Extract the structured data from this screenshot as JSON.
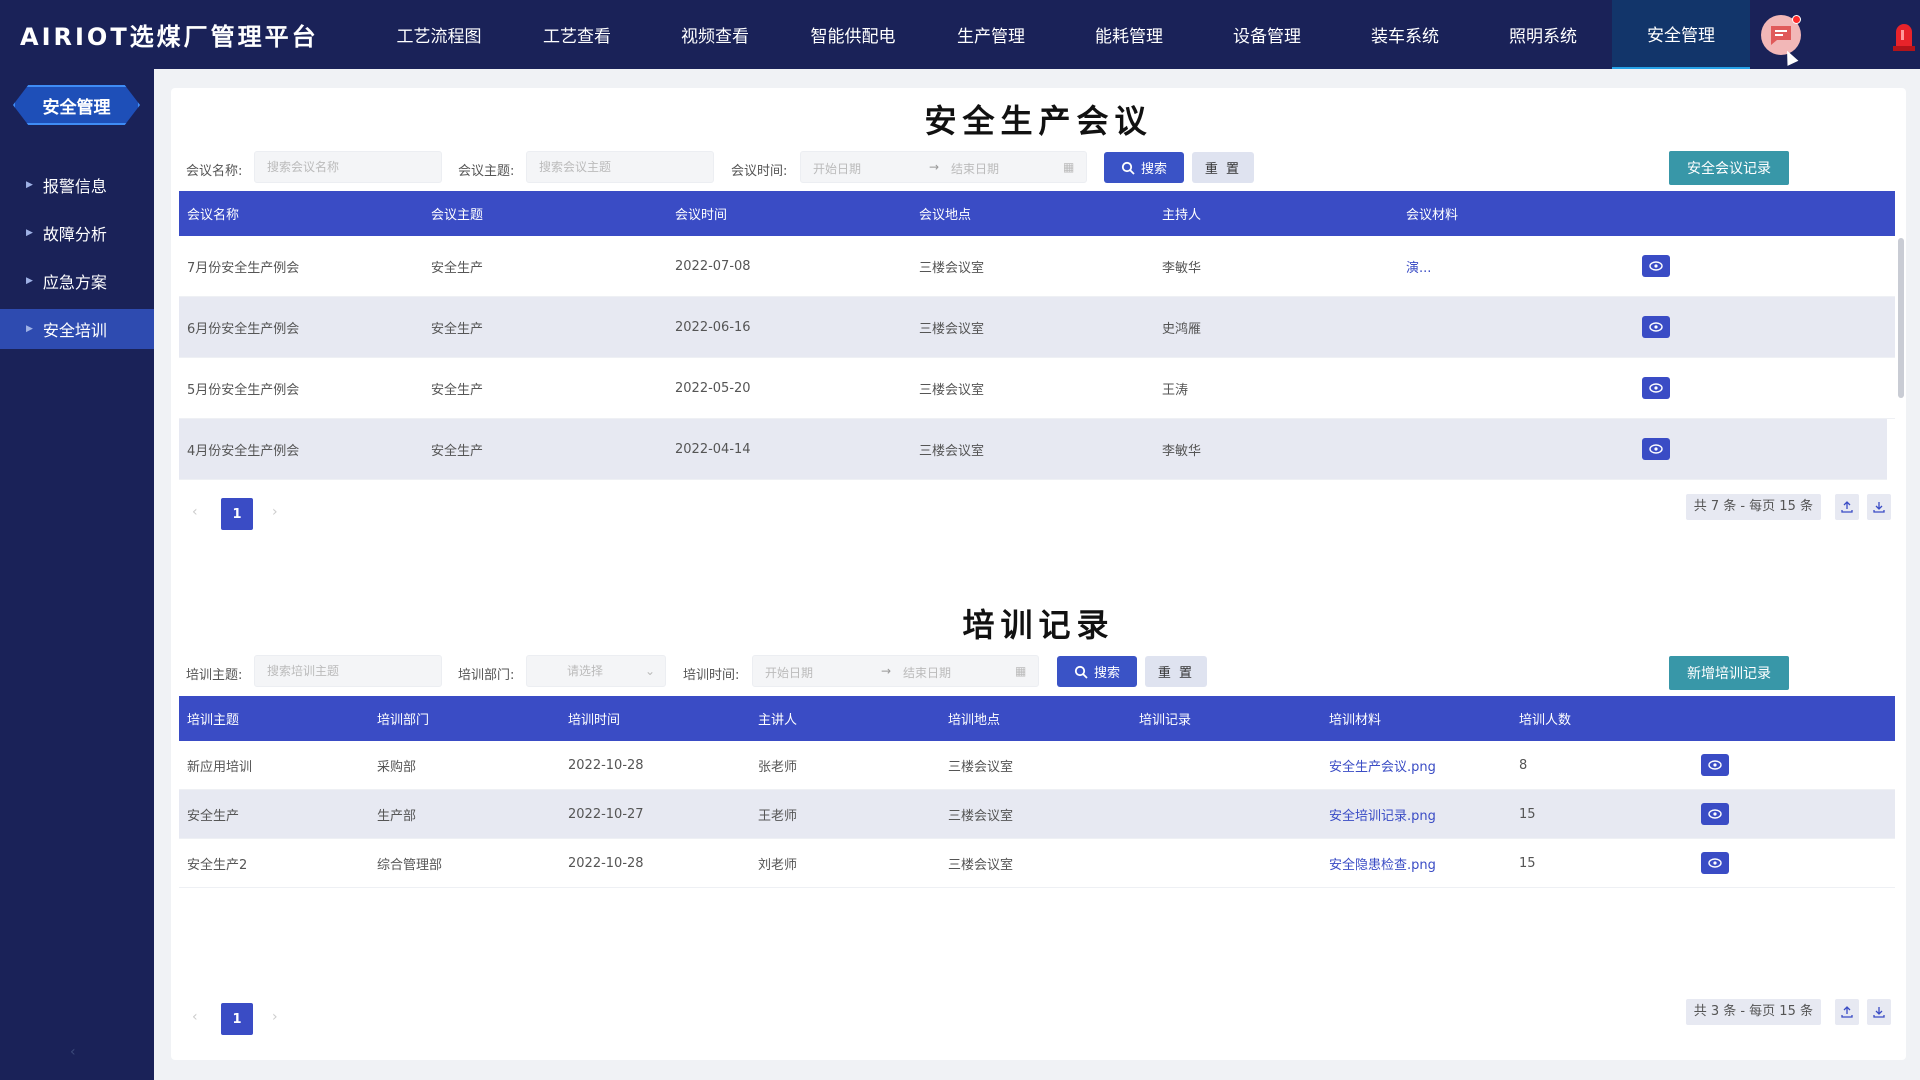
{
  "app": {
    "title": "AIRIOT选煤厂管理平台"
  },
  "nav": [
    {
      "label": "工艺流程图"
    },
    {
      "label": "工艺查看"
    },
    {
      "label": "视频查看"
    },
    {
      "label": "智能供配电"
    },
    {
      "label": "生产管理"
    },
    {
      "label": "能耗管理"
    },
    {
      "label": "设备管理"
    },
    {
      "label": "装车系统"
    },
    {
      "label": "照明系统"
    },
    {
      "label": "安全管理"
    }
  ],
  "nav_active": "安全管理",
  "sidebar": {
    "title": "安全管理",
    "items": [
      {
        "label": "报警信息"
      },
      {
        "label": "故障分析"
      },
      {
        "label": "应急方案"
      },
      {
        "label": "安全培训"
      }
    ],
    "active": "安全培训"
  },
  "meeting": {
    "title": "安全生产会议",
    "filter": {
      "name_label": "会议名称:",
      "name_placeholder": "搜索会议名称",
      "topic_label": "会议主题:",
      "topic_placeholder": "搜索会议主题",
      "time_label": "会议时间:",
      "start_placeholder": "开始日期",
      "end_placeholder": "结束日期",
      "search_label": "搜索",
      "reset_label": "重 置",
      "record_button": "安全会议记录"
    },
    "columns": [
      "会议名称",
      "会议主题",
      "会议时间",
      "会议地点",
      "主持人",
      "会议材料"
    ],
    "rows": [
      {
        "name": "7月份安全生产例会",
        "topic": "安全生产",
        "date": "2022-07-08",
        "place": "三楼会议室",
        "host": "李敏华",
        "material": "演..."
      },
      {
        "name": "6月份安全生产例会",
        "topic": "安全生产",
        "date": "2022-06-16",
        "place": "三楼会议室",
        "host": "史鸿雁",
        "material": ""
      },
      {
        "name": "5月份安全生产例会",
        "topic": "安全生产",
        "date": "2022-05-20",
        "place": "三楼会议室",
        "host": "王涛",
        "material": ""
      },
      {
        "name": "4月份安全生产例会",
        "topic": "安全生产",
        "date": "2022-04-14",
        "place": "三楼会议室",
        "host": "李敏华",
        "material": ""
      }
    ],
    "pagination": {
      "current": "1",
      "total_text": "共 7 条 - 每页 15 条"
    }
  },
  "training": {
    "title": "培训记录",
    "filter": {
      "topic_label": "培训主题:",
      "topic_placeholder": "搜索培训主题",
      "dept_label": "培训部门:",
      "dept_placeholder": "请选择",
      "time_label": "培训时间:",
      "start_placeholder": "开始日期",
      "end_placeholder": "结束日期",
      "search_label": "搜索",
      "reset_label": "重 置",
      "add_button": "新增培训记录"
    },
    "columns": [
      "培训主题",
      "培训部门",
      "培训时间",
      "主讲人",
      "培训地点",
      "培训记录",
      "培训材料",
      "培训人数"
    ],
    "rows": [
      {
        "topic": "新应用培训",
        "dept": "采购部",
        "date": "2022-10-28",
        "speaker": "张老师",
        "place": "三楼会议室",
        "record": "",
        "material": "安全生产会议.png",
        "count": "8"
      },
      {
        "topic": "安全生产",
        "dept": "生产部",
        "date": "2022-10-27",
        "speaker": "王老师",
        "place": "三楼会议室",
        "record": "",
        "material": "安全培训记录.png",
        "count": "15"
      },
      {
        "topic": "安全生产2",
        "dept": "综合管理部",
        "date": "2022-10-28",
        "speaker": "刘老师",
        "place": "三楼会议室",
        "record": "",
        "material": "安全隐患检查.png",
        "count": "15"
      }
    ],
    "pagination": {
      "current": "1",
      "total_text": "共 3 条 - 每页 15 条"
    }
  },
  "colors": {
    "header_bg": "#1a2258",
    "primary": "#3a4cc5",
    "teal": "#3897a8",
    "row_alt": "#e7e9f2"
  }
}
